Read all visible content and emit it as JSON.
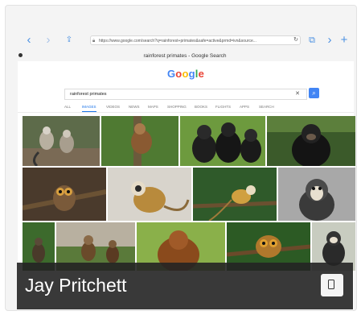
{
  "browser": {
    "url": "https://www.google.com/search?q=rainforest+primates&safe=active&prmd=ivn&source...",
    "page_title": "rainforest primates - Google Search"
  },
  "google": {
    "logo": "Google",
    "query": "rainforest primates",
    "tabs": [
      "ALL",
      "IMAGES",
      "VIDEOS",
      "NEWS",
      "MAPS",
      "SHOPPING",
      "BOOKS",
      "FLIGHTS",
      "APPS",
      "SEARCH"
    ],
    "active_tab": "IMAGES"
  },
  "overlay": {
    "name": "Jay Pritchett"
  },
  "colors": {
    "accent_blue": "#4285f4",
    "overlay_bg": "#232323"
  },
  "icons": [
    "back-icon",
    "forward-icon",
    "share-icon",
    "lock-icon",
    "reload-icon",
    "tabs-icon",
    "forward-alt-icon",
    "add-icon",
    "search-icon",
    "clear-icon",
    "fullscreen-icon"
  ]
}
